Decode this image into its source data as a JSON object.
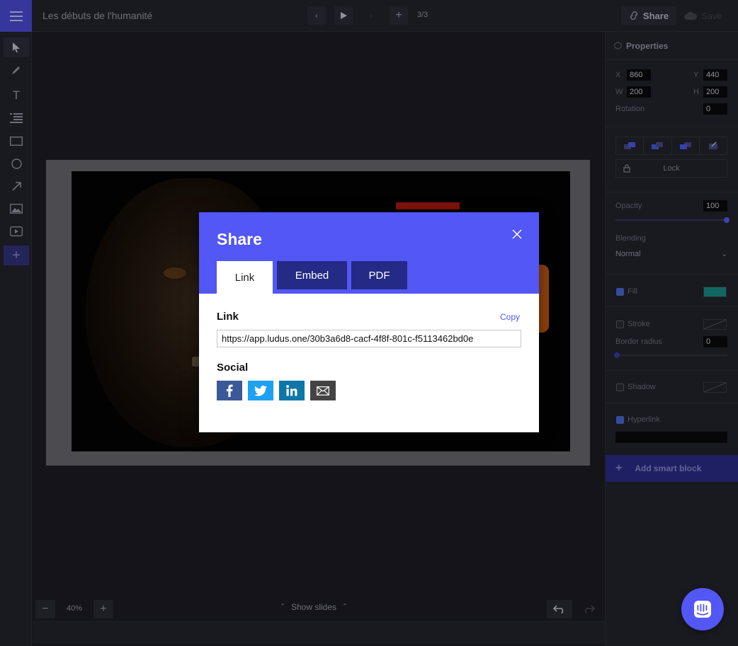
{
  "header": {
    "document_title": "Les débuts de l'humanité",
    "slide_counter": "3/3",
    "share_label": "Share",
    "save_label": "Save"
  },
  "canvas": {
    "zoom": "40%",
    "show_slides_label": "Show slides"
  },
  "properties": {
    "title": "Properties",
    "x_label": "X",
    "x_value": "860",
    "y_label": "Y",
    "y_value": "440",
    "w_label": "W",
    "w_value": "200",
    "h_label": "H",
    "h_value": "200",
    "rotation_label": "Rotation",
    "rotation_value": "0",
    "lock_label": "Lock",
    "opacity_label": "Opacity",
    "opacity_value": "100",
    "blending_label": "Blending",
    "blending_value": "Normal",
    "fill_label": "Fill",
    "fill_color": "#1a8f8a",
    "stroke_label": "Stroke",
    "border_radius_label": "Border radius",
    "border_radius_value": "0",
    "shadow_label": "Shadow",
    "hyperlink_label": "Hyperlink",
    "add_smart_block_label": "Add smart block"
  },
  "modal": {
    "title": "Share",
    "tabs": [
      {
        "label": "Link",
        "active": true
      },
      {
        "label": "Embed",
        "active": false
      },
      {
        "label": "PDF",
        "active": false
      }
    ],
    "link_section_label": "Link",
    "copy_label": "Copy",
    "link_url": "https://app.ludus.one/30b3a6d8-cacf-4f8f-801c-f5113462bd0e",
    "social_section_label": "Social",
    "social": [
      {
        "name": "facebook",
        "icon": "facebook-icon",
        "color": "#3b5998"
      },
      {
        "name": "twitter",
        "icon": "twitter-icon",
        "color": "#1da1f2"
      },
      {
        "name": "linkedin",
        "icon": "linkedin-icon",
        "color": "#0e76a8"
      },
      {
        "name": "email",
        "icon": "mail-icon",
        "color": "#444444"
      }
    ]
  },
  "colors": {
    "accent": "#5257f5",
    "tab_inactive": "#242a85",
    "menu_button": "#4b4bd8"
  }
}
